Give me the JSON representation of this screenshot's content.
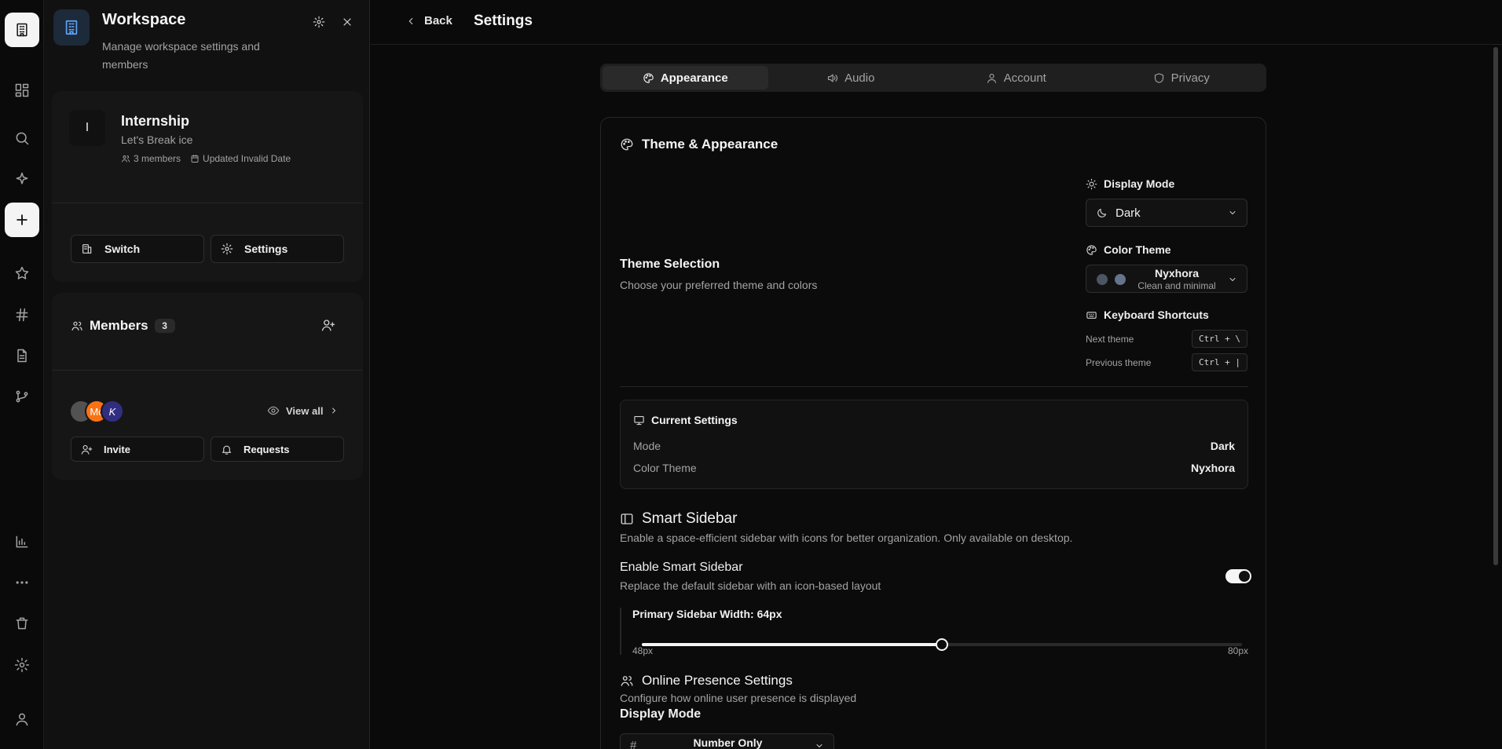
{
  "rail": {
    "icons": [
      "building-icon",
      "dashboard-icon",
      "search-icon",
      "sparkles-icon",
      "plus-icon",
      "star-icon",
      "hash-icon",
      "document-icon",
      "git-branch-icon",
      "bar-chart-icon",
      "more-icon",
      "trash-icon",
      "gear-icon",
      "user-icon"
    ]
  },
  "workspace": {
    "title": "Workspace",
    "description": "Manage workspace settings and members",
    "org": {
      "letter": "I",
      "name": "Internship",
      "tagline": "Let's Break ice",
      "members": "3 members",
      "updated": "Updated Invalid Date"
    },
    "switch_label": "Switch",
    "settings_label": "Settings",
    "members_title": "Members",
    "members_count": "3",
    "avatars": [
      "",
      "Mc",
      "K"
    ],
    "view_all": "View all",
    "invite_label": "Invite",
    "requests_label": "Requests"
  },
  "header": {
    "back_label": "Back",
    "title": "Settings"
  },
  "tabs": [
    {
      "label": "Appearance",
      "active": true
    },
    {
      "label": "Audio",
      "active": false
    },
    {
      "label": "Account",
      "active": false
    },
    {
      "label": "Privacy",
      "active": false
    }
  ],
  "theme": {
    "section_title": "Theme & Appearance",
    "selection_title": "Theme Selection",
    "selection_desc": "Choose your preferred theme and colors",
    "display_mode_label": "Display Mode",
    "display_mode_value": "Dark",
    "color_theme_label": "Color Theme",
    "color_theme_name": "Nyxhora",
    "color_theme_desc": "Clean and minimal",
    "color_dots": [
      "#4b5563",
      "#64748b"
    ],
    "shortcuts_label": "Keyboard Shortcuts",
    "next_label": "Next theme",
    "next_key": "Ctrl + \\",
    "prev_label": "Previous theme",
    "prev_key": "Ctrl + |"
  },
  "current": {
    "title": "Current Settings",
    "mode_label": "Mode",
    "mode_value": "Dark",
    "color_label": "Color Theme",
    "color_value": "Nyxhora"
  },
  "smart_sidebar": {
    "title": "Smart Sidebar",
    "desc": "Enable a space-efficient sidebar with icons for better organization. Only available on desktop.",
    "enable_title": "Enable Smart Sidebar",
    "enable_desc": "Replace the default sidebar with an icon-based layout",
    "enabled": true,
    "width_label": "Primary Sidebar Width: 64px",
    "min_label": "48px",
    "max_label": "80px",
    "value_fraction": 0.5
  },
  "presence": {
    "title": "Online Presence Settings",
    "desc": "Configure how online user presence is displayed",
    "display_mode_title": "Display Mode",
    "display_mode_value": "Number Only"
  }
}
